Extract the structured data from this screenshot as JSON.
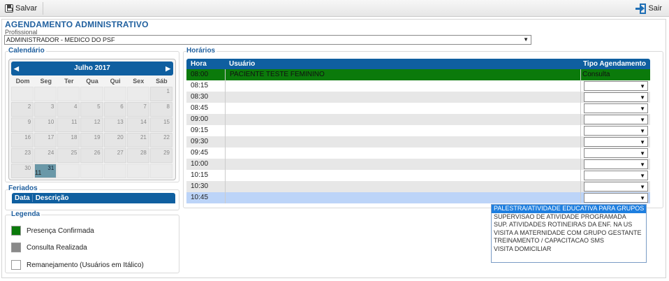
{
  "toolbar": {
    "save_label": "Salvar",
    "exit_label": "Sair"
  },
  "page": {
    "title": "AGENDAMENTO ADMINISTRATIVO",
    "profissional_label": "Profissional",
    "profissional_value": "ADMINISTRADOR - MEDICO DO PSF"
  },
  "calendar": {
    "group_label": "Calendário",
    "month_label": "Julho 2017",
    "prev": "◀",
    "next": "▶",
    "dows": [
      "Dom",
      "Seg",
      "Ter",
      "Qua",
      "Qui",
      "Sex",
      "Sáb"
    ],
    "weeks": [
      [
        "",
        "",
        "",
        "",
        "",
        "",
        "1"
      ],
      [
        "2",
        "3",
        "4",
        "5",
        "6",
        "7",
        "8"
      ],
      [
        "9",
        "10",
        "11",
        "12",
        "13",
        "14",
        "15"
      ],
      [
        "16",
        "17",
        "18",
        "19",
        "20",
        "21",
        "22"
      ],
      [
        "23",
        "24",
        "25",
        "26",
        "27",
        "28",
        "29"
      ],
      [
        "30",
        "31",
        "",
        "",
        "",
        "",
        ""
      ]
    ],
    "selected_day": "31",
    "extra_text": "11"
  },
  "feriados": {
    "group_label": "Feriados",
    "col_data": "Data",
    "col_descricao": "Descrição"
  },
  "legenda": {
    "group_label": "Legenda",
    "items": [
      {
        "label": "Presença Confirmada",
        "color": "#0b7a0b"
      },
      {
        "label": "Consulta Realizada",
        "color": "#8a8a8a"
      },
      {
        "label": "Remanejamento (Usuários em Itálico)",
        "color": "#ffffff"
      }
    ]
  },
  "horarios": {
    "group_label": "Horários",
    "col_hora": "Hora",
    "col_usuario": "Usuário",
    "col_tipo": "Tipo Agendamento",
    "rows": [
      {
        "hora": "08:00",
        "usuario": "PACIENTE TESTE FEMININO",
        "tipo": "Consulta"
      },
      {
        "hora": "08:15",
        "usuario": "",
        "tipo": ""
      },
      {
        "hora": "08:30",
        "usuario": "",
        "tipo": ""
      },
      {
        "hora": "08:45",
        "usuario": "",
        "tipo": ""
      },
      {
        "hora": "09:00",
        "usuario": "",
        "tipo": ""
      },
      {
        "hora": "09:15",
        "usuario": "",
        "tipo": ""
      },
      {
        "hora": "09:30",
        "usuario": "",
        "tipo": ""
      },
      {
        "hora": "09:45",
        "usuario": "",
        "tipo": ""
      },
      {
        "hora": "10:00",
        "usuario": "",
        "tipo": ""
      },
      {
        "hora": "10:15",
        "usuario": "",
        "tipo": ""
      },
      {
        "hora": "10:30",
        "usuario": "",
        "tipo": ""
      },
      {
        "hora": "10:45",
        "usuario": "",
        "tipo": ""
      }
    ],
    "dropdown_options": [
      "PALESTRA/ATIVIDADE EDUCATIVA PARA GRUPOS",
      "SUPERVISAO DE ATIVIDADE PROGRAMADA",
      "SUP. ATIVIDADES ROTINEIRAS DA ENF. NA US",
      "VISITA A MATERNIDADE COM GRUPO GESTANTE",
      "TREINAMENTO / CAPACITACAO SMS",
      "VISITA DOMICILIAR"
    ]
  },
  "colors": {
    "accent": "#0f5fa0",
    "title": "#1f5f9e",
    "confirmed": "#0b7a0b",
    "highlight": "#1e7fe0"
  }
}
